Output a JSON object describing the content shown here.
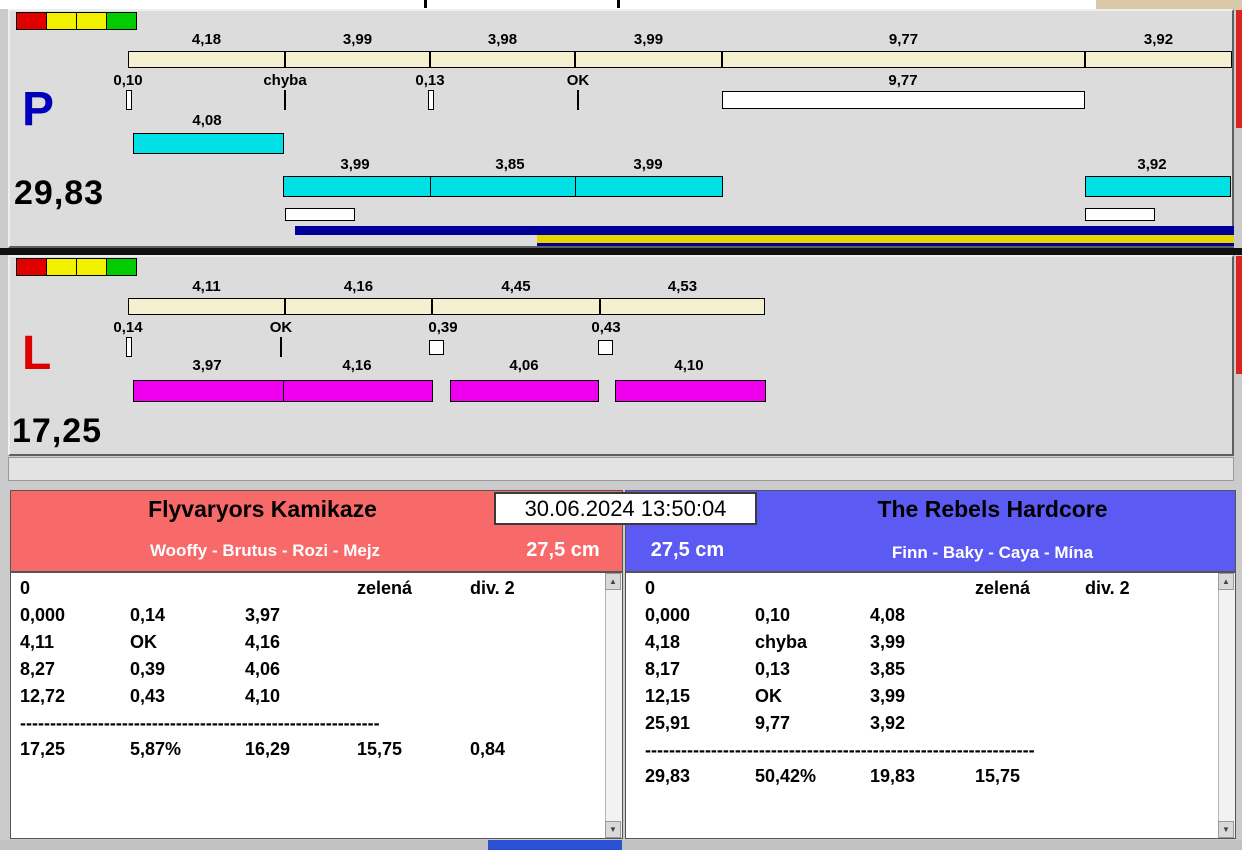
{
  "window": {
    "datetime": "30.06.2024 13:50:04"
  },
  "p_panel": {
    "letter": "P",
    "total": "29,83",
    "accent_color": "#0000bb",
    "bar_color": "#00e1e6",
    "progress_blue": "#000099",
    "progress_yellow": "#e8d400",
    "lights": [
      "#e10000",
      "#f0f000",
      "#f0f000",
      "#00cc00"
    ],
    "segments": [
      "4,18",
      "3,99",
      "3,98",
      "3,99",
      "9,77",
      "3,92"
    ],
    "marks": [
      "0,10",
      "chyba",
      "0,13",
      "OK",
      "9,77"
    ],
    "runs": [
      "4,08",
      "3,99",
      "3,85",
      "3,99",
      "3,92"
    ]
  },
  "l_panel": {
    "letter": "L",
    "total": "17,25",
    "accent_color": "#dd0000",
    "bar_color": "#ee00ee",
    "lights": [
      "#e10000",
      "#f0f000",
      "#f0f000",
      "#00cc00"
    ],
    "segments": [
      "4,11",
      "4,16",
      "4,45",
      "4,53"
    ],
    "marks": [
      "0,14",
      "OK",
      "0,39",
      "0,43"
    ],
    "runs": [
      "3,97",
      "4,16",
      "4,06",
      "4,10"
    ]
  },
  "left_team": {
    "name": "Flyvaryors Kamikaze",
    "dogs": "Wooffy - Brutus - Rozi - Mejz",
    "jump_height": "27,5 cm",
    "header_color": "#f86969",
    "rows": [
      [
        "0",
        "",
        "",
        "zelená",
        "div. 2"
      ],
      [
        "0,000",
        "0,14",
        "3,97",
        "",
        ""
      ],
      [
        "4,11",
        "OK",
        "4,16",
        "",
        ""
      ],
      [
        "8,27",
        "0,39",
        "4,06",
        "",
        ""
      ],
      [
        "12,72",
        "0,43",
        "4,10",
        "",
        ""
      ]
    ],
    "separator": "------------------------------------------------------------",
    "summary": [
      "17,25",
      "5,87%",
      "16,29",
      "15,75",
      "0,84"
    ]
  },
  "right_team": {
    "name": "The Rebels Hardcore",
    "dogs": "Finn - Baky - Caya - Mína",
    "jump_height": "27,5 cm",
    "header_color": "#5b5bf3",
    "rows": [
      [
        "0",
        "",
        "",
        "zelená",
        "div. 2"
      ],
      [
        "0,000",
        "0,10",
        "4,08",
        "",
        ""
      ],
      [
        "4,18",
        "chyba",
        "3,99",
        "",
        ""
      ],
      [
        "8,17",
        "0,13",
        "3,85",
        "",
        ""
      ],
      [
        "12,15",
        "OK",
        "3,99",
        "",
        ""
      ],
      [
        "25,91",
        "9,77",
        "3,92",
        "",
        ""
      ]
    ],
    "separator": "-----------------------------------------------------------------",
    "summary": [
      "29,83",
      "50,42%",
      "19,83",
      "15,75",
      ""
    ]
  }
}
